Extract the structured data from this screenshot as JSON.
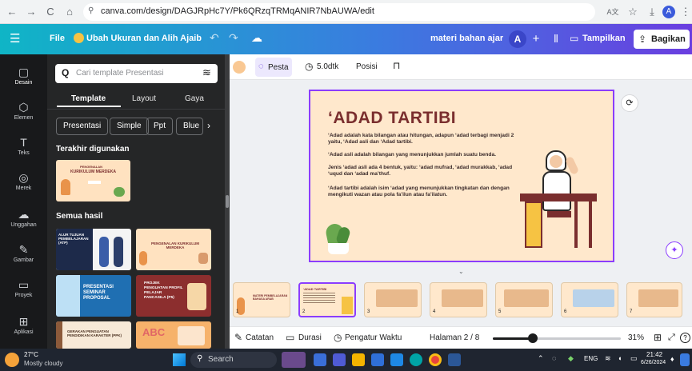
{
  "browser": {
    "url": "canva.com/design/DAGJRpHc7Y/Pk6QRzqTRMqANIR7NbAUWA/edit",
    "back": "←",
    "forward": "→",
    "reload": "C",
    "home": "⌂",
    "site_info": "⚲",
    "translate": "A文",
    "star": "☆",
    "download": "⤓",
    "profile": "A",
    "menu": "⋮"
  },
  "topbar": {
    "menu": "☰",
    "file": "File",
    "resize": "Ubah Ukuran dan Alih Ajaib",
    "undo": "↶",
    "redo": "↷",
    "cloud": "☁",
    "title": "materi bahan ajar",
    "avatar": "A",
    "add": "+",
    "stats": "⫴",
    "present_icon": "▭",
    "present": "Tampilkan",
    "share_icon": "⇪",
    "share": "Bagikan"
  },
  "rail": [
    {
      "icon": "▢",
      "label": "Desain"
    },
    {
      "icon": "⬡",
      "label": "Elemen"
    },
    {
      "icon": "T",
      "label": "Teks"
    },
    {
      "icon": "◎",
      "label": "Merek"
    },
    {
      "icon": "☁",
      "label": "Unggahan"
    },
    {
      "icon": "✎",
      "label": "Gambar"
    },
    {
      "icon": "▭",
      "label": "Proyek"
    },
    {
      "icon": "⊞",
      "label": "Aplikasi"
    }
  ],
  "panel": {
    "search_placeholder": "Cari template Presentasi",
    "search_icon": "Q",
    "filter_icon": "≋",
    "tabs": [
      "Template",
      "Layout",
      "Gaya"
    ],
    "chips": [
      "Presentasi",
      "Simple",
      "Ppt",
      "Blue"
    ],
    "chip_next": "›",
    "recent_title": "Terakhir digunakan",
    "all_title": "Semua hasil",
    "recent_thumb": {
      "line1": "PENGENALAN",
      "line2": "KURIKULUM MERDEKA"
    },
    "results": [
      {
        "text": "ALUR TUJUAN PEMBELAJARAN (ATP)"
      },
      {
        "text": "PENGENALAN KURIKULUM MERDEKA"
      },
      {
        "text": "PRESENTASI SEMINAR PROPOSAL"
      },
      {
        "text": "PROJEK PENGUATAN PROFIL PELAJAR PANCASILA (P5)"
      },
      {
        "text": "GERAKAN PENGUATAN PENDIDIKAN KARAKTER (PPK)"
      },
      {
        "text": "ABC"
      }
    ]
  },
  "toolbar": {
    "pesta": "Pesta",
    "duration": "5.0dtk",
    "position": "Posisi",
    "lock": "⊓"
  },
  "slide": {
    "title": "‘ADAD TARTIBI",
    "para1": "‘Adad adalah kata bilangan atau hitungan, adapun ‘adad terbagi menjadi 2 yaitu, ‘Adad asli dan ‘Adad tartibi.",
    "para2": "‘Adad asli adalah bilangan yang menunjukkan jumlah suatu benda.",
    "para3": "Jenis ‘adad asli ada 4 bentuk, yaitu: ‘adad mufrad, ‘adad murakkab, ‘adad ‘uqud dan ‘adad ma’thuf.",
    "para4": "‘Adad tartibi adalah isim ‘adad yang menunjukkan tingkatan dan dengan mengikuti wazan atau pola fa’ilun atau fa’ilatun."
  },
  "filmstrip": {
    "thumbs": [
      {
        "num": "1",
        "label": "MATERI PEMBELAJARAN BAHASA ARAB"
      },
      {
        "num": "2",
        "label": "‘ADAD TARTIBI"
      },
      {
        "num": "3",
        "label": ""
      },
      {
        "num": "4",
        "label": ""
      },
      {
        "num": "5",
        "label": ""
      },
      {
        "num": "6",
        "label": ""
      },
      {
        "num": "7",
        "label": ""
      }
    ]
  },
  "bottombar": {
    "notes": "Catatan",
    "duration": "Durasi",
    "timer": "Pengatur Waktu",
    "page": "Halaman 2 / 8",
    "zoom": "31%",
    "zoom_fraction": 0.31,
    "grid": "⊞",
    "fullscreen": "⤢",
    "help": "?"
  },
  "taskbar": {
    "temp": "27°C",
    "weather": "Mostly cloudy",
    "search": "Search",
    "lang": "ENG",
    "time": "21:42",
    "date": "6/26/2024"
  },
  "colors": {
    "accent": "#8b3dff",
    "slide_bg": "#ffe8cc",
    "title_color": "#7a2e2e"
  }
}
